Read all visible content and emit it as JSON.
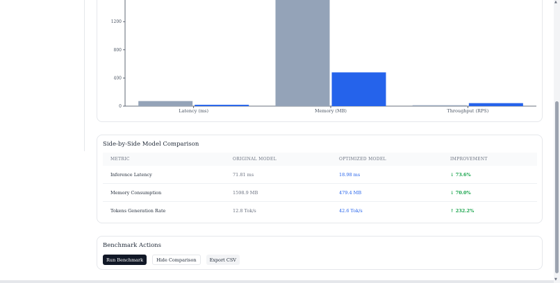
{
  "chart_data": {
    "type": "bar",
    "categories": [
      "Latency (ms)",
      "Memory (MB)",
      "Throughput (RPS)"
    ],
    "series": [
      {
        "values": [
          71.81,
          1598.9,
          12.8
        ],
        "color": "#94a3b8"
      },
      {
        "values": [
          18.98,
          479.4,
          42.6
        ],
        "color": "#2563eb"
      }
    ],
    "yticks": [
      0,
      400,
      800,
      1200
    ],
    "ylim": [
      0,
      1500
    ]
  },
  "comparison": {
    "title": "Side-by-Side Model Comparison",
    "headers": [
      "METRIC",
      "ORIGINAL MODEL",
      "OPTIMIZED MODEL",
      "IMPROVEMENT"
    ],
    "rows": [
      {
        "metric": "Inference Latency",
        "original": "71.81 ms",
        "optimized": "18.98 ms",
        "improvement": "↓ 73.6%"
      },
      {
        "metric": "Memory Consumption",
        "original": "1598.9 MB",
        "optimized": "479.4 MB",
        "improvement": "↓ 70.0%"
      },
      {
        "metric": "Tokens Generation Rate",
        "original": "12.8 Tok/s",
        "optimized": "42.6 Tok/s",
        "improvement": "↑ 232.2%"
      }
    ]
  },
  "actions": {
    "title": "Benchmark Actions",
    "run": "Run Benchmark",
    "hide": "Hide Comparison",
    "export": "Export CSV"
  }
}
